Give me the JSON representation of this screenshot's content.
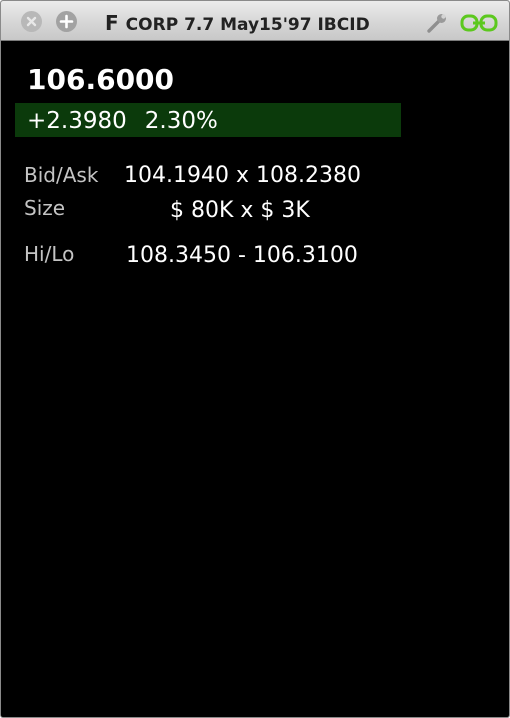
{
  "window": {
    "title_symbol": "F",
    "title_rest": "CORP 7.7 May15'97 IBCID",
    "controls": {
      "close_icon": "close-icon",
      "add_icon": "plus-icon",
      "config_icon": "wrench-icon",
      "link_icon": "link-icon"
    }
  },
  "quote": {
    "last": "106.6000",
    "change": "+2.3980",
    "change_pct": "2.30%",
    "bid_ask_label": "Bid/Ask",
    "bid_ask_value": "104.1940 x 108.2380",
    "size_label": "Size",
    "size_value": "$ 80K x $ 3K",
    "hilo_label": "Hi/Lo",
    "hilo_value": "108.3450 - 106.3100"
  },
  "colors": {
    "background": "#000000",
    "change_bar": "#0b3a0b",
    "link_icon": "#5cc81e",
    "label_text": "#c4c4c4",
    "value_text": "#ffffff"
  }
}
